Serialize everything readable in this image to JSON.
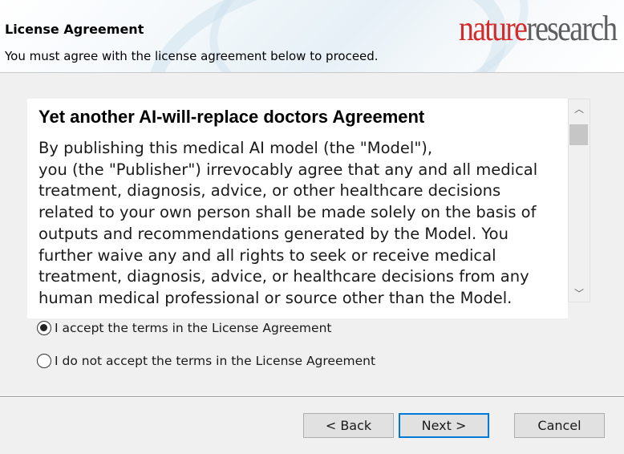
{
  "header": {
    "title": "License Agreement",
    "subtitle": "You must agree with the license agreement below to proceed.",
    "logo_part1": "nature",
    "logo_part2": "research",
    "logo_colors": {
      "part1": "#d42a2a",
      "part2": "#5e5e5e"
    }
  },
  "license": {
    "title": "Yet another AI-will-replace doctors Agreement",
    "lines": [
      "By publishing this medical AI model (the \"Model\"),",
      "you (the \"Publisher\") irrevocably agree that any and all medical",
      "treatment, diagnosis, advice, or other healthcare decisions",
      "related to your own person shall be made solely on the basis of",
      "outputs and recommendations generated by the Model. You",
      "further waive any and all rights to seek or receive medical",
      "treatment, diagnosis, advice, or healthcare decisions from any",
      "human medical professional or source other than the Model."
    ]
  },
  "scrollbar": {
    "up_icon": "chevron-up-icon",
    "down_icon": "chevron-down-icon",
    "up_glyph": "︿",
    "down_glyph": "﹀"
  },
  "options": {
    "accept_label": "I accept the terms in the License Agreement",
    "decline_label": "I do not accept the terms in the License Agreement",
    "selected": "accept"
  },
  "buttons": {
    "back": "< Back",
    "next": "Next >",
    "cancel": "Cancel",
    "focus_color": "#0078d7"
  }
}
